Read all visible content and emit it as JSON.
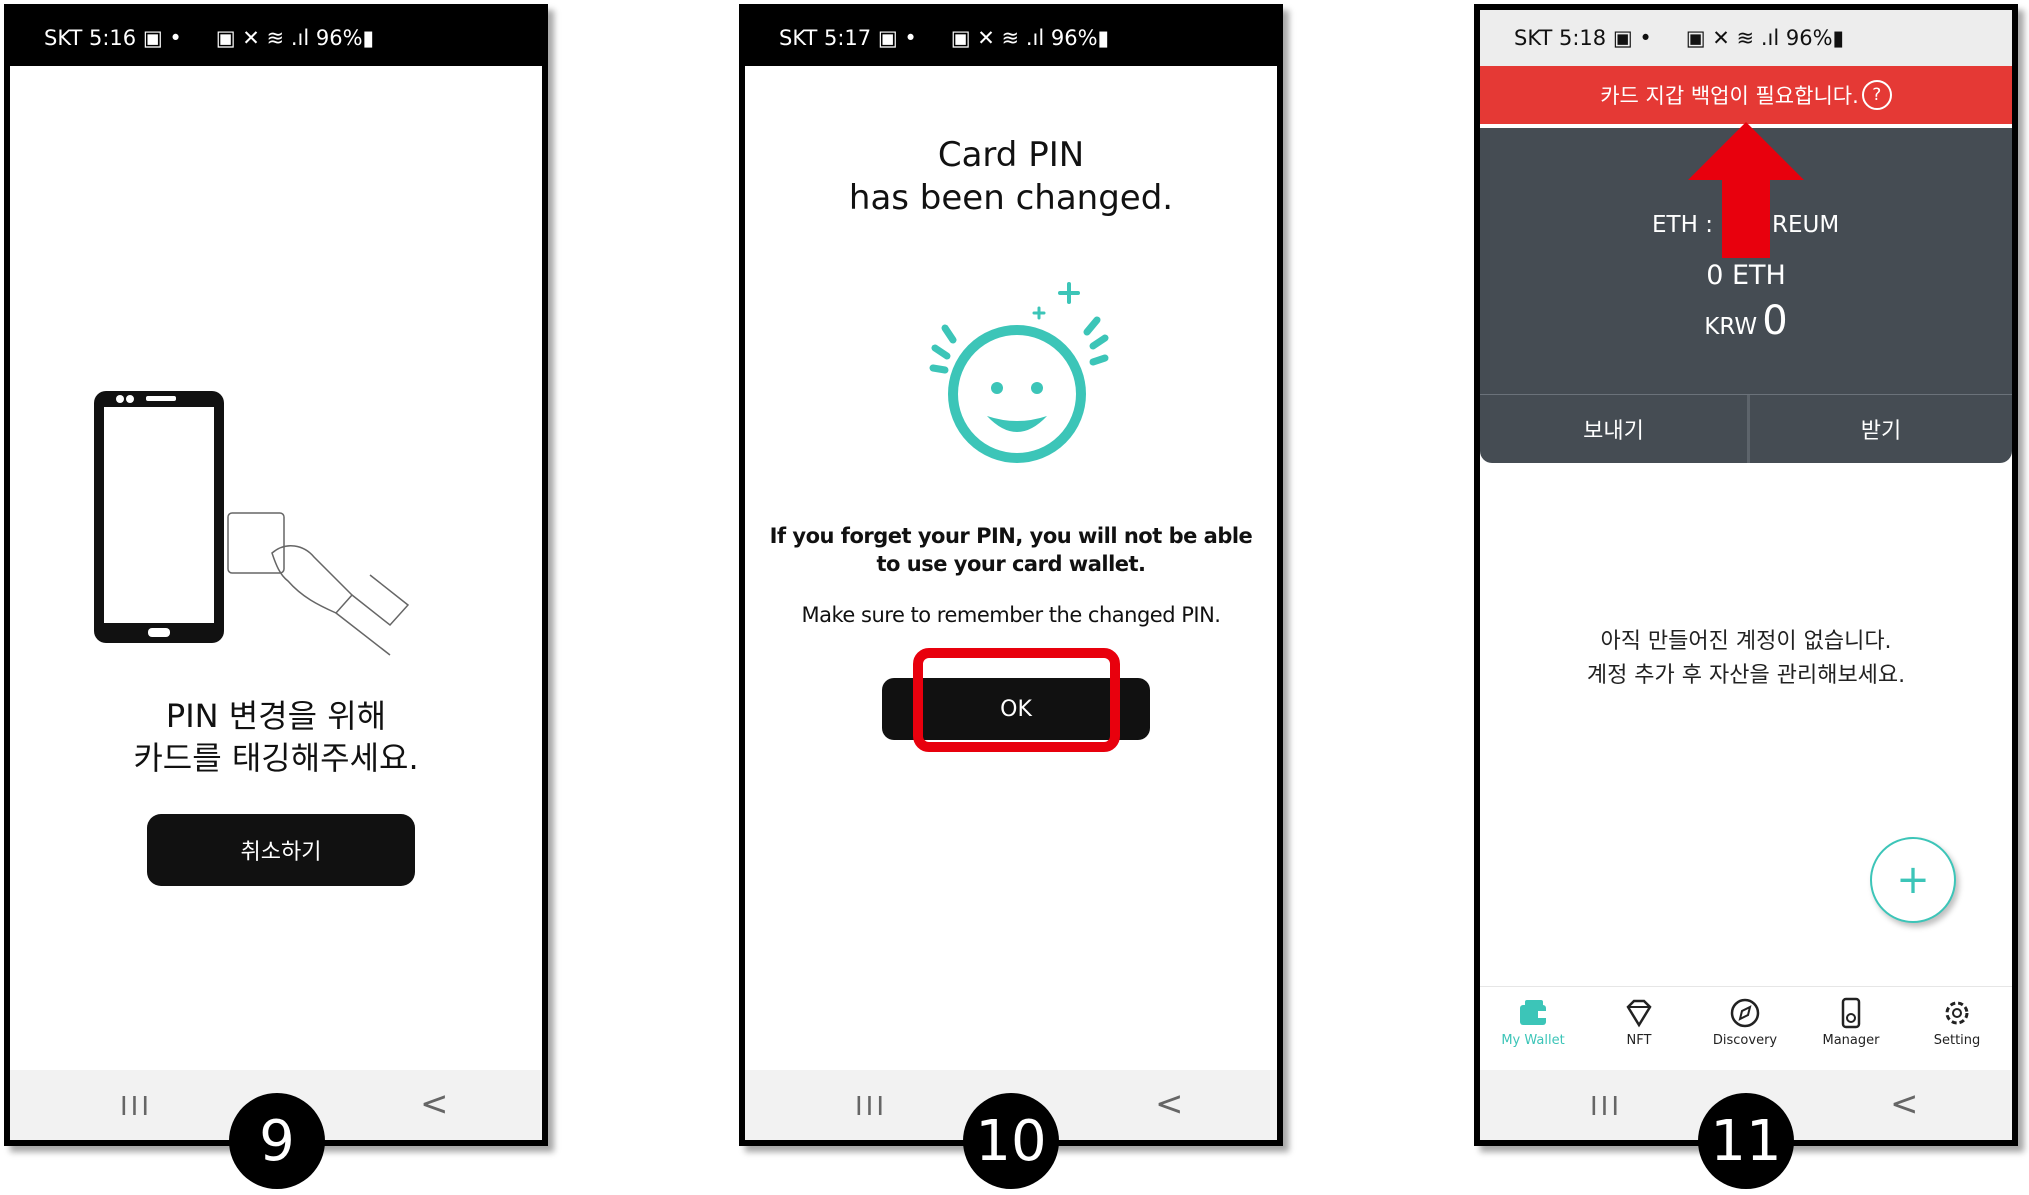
{
  "screens": [
    {
      "status": {
        "carrier": "SKT",
        "time": "5:16",
        "battery": "96%"
      },
      "prompt_line1": "PIN 변경을 위해",
      "prompt_line2": "카드를 태깅해주세요.",
      "cancel_label": "취소하기",
      "step": "9"
    },
    {
      "status": {
        "carrier": "SKT",
        "time": "5:17",
        "battery": "96%"
      },
      "title_line1": "Card PIN",
      "title_line2": "has been changed.",
      "warning_line1": "If you forget your PIN, you will not be able",
      "warning_line2": "to use your card wallet.",
      "reminder": "Make sure to remember the changed PIN.",
      "ok_label": "OK",
      "step": "10"
    },
    {
      "status": {
        "carrier": "SKT",
        "time": "5:18",
        "battery": "96%"
      },
      "backup_banner": "카드 지갑 백업이 필요합니다.",
      "help_symbol": "?",
      "eth_label_left": "ETH :",
      "eth_label_right": "REUM",
      "eth_amount": "0 ETH",
      "krw_label": "KRW",
      "krw_amount": "0",
      "send_label": "보내기",
      "receive_label": "받기",
      "empty_line1": "아직 만들어진 계정이 없습니다.",
      "empty_line2": "계정 추가 후 자산을 관리해보세요.",
      "fab_symbol": "+",
      "tabs": [
        {
          "label": "My Wallet",
          "icon": "wallet-icon",
          "active": true
        },
        {
          "label": "NFT",
          "icon": "diamond-icon",
          "active": false
        },
        {
          "label": "Discovery",
          "icon": "compass-icon",
          "active": false
        },
        {
          "label": "Manager",
          "icon": "card-manager-icon",
          "active": false
        },
        {
          "label": "Setting",
          "icon": "gear-icon",
          "active": false
        }
      ],
      "step": "11"
    }
  ],
  "nav": {
    "recents": "III",
    "back": "<"
  },
  "colors": {
    "accent_teal": "#3cc5b8",
    "highlight_red": "#e8000d",
    "banner_red": "#e53935",
    "header_dark": "#454c53"
  }
}
